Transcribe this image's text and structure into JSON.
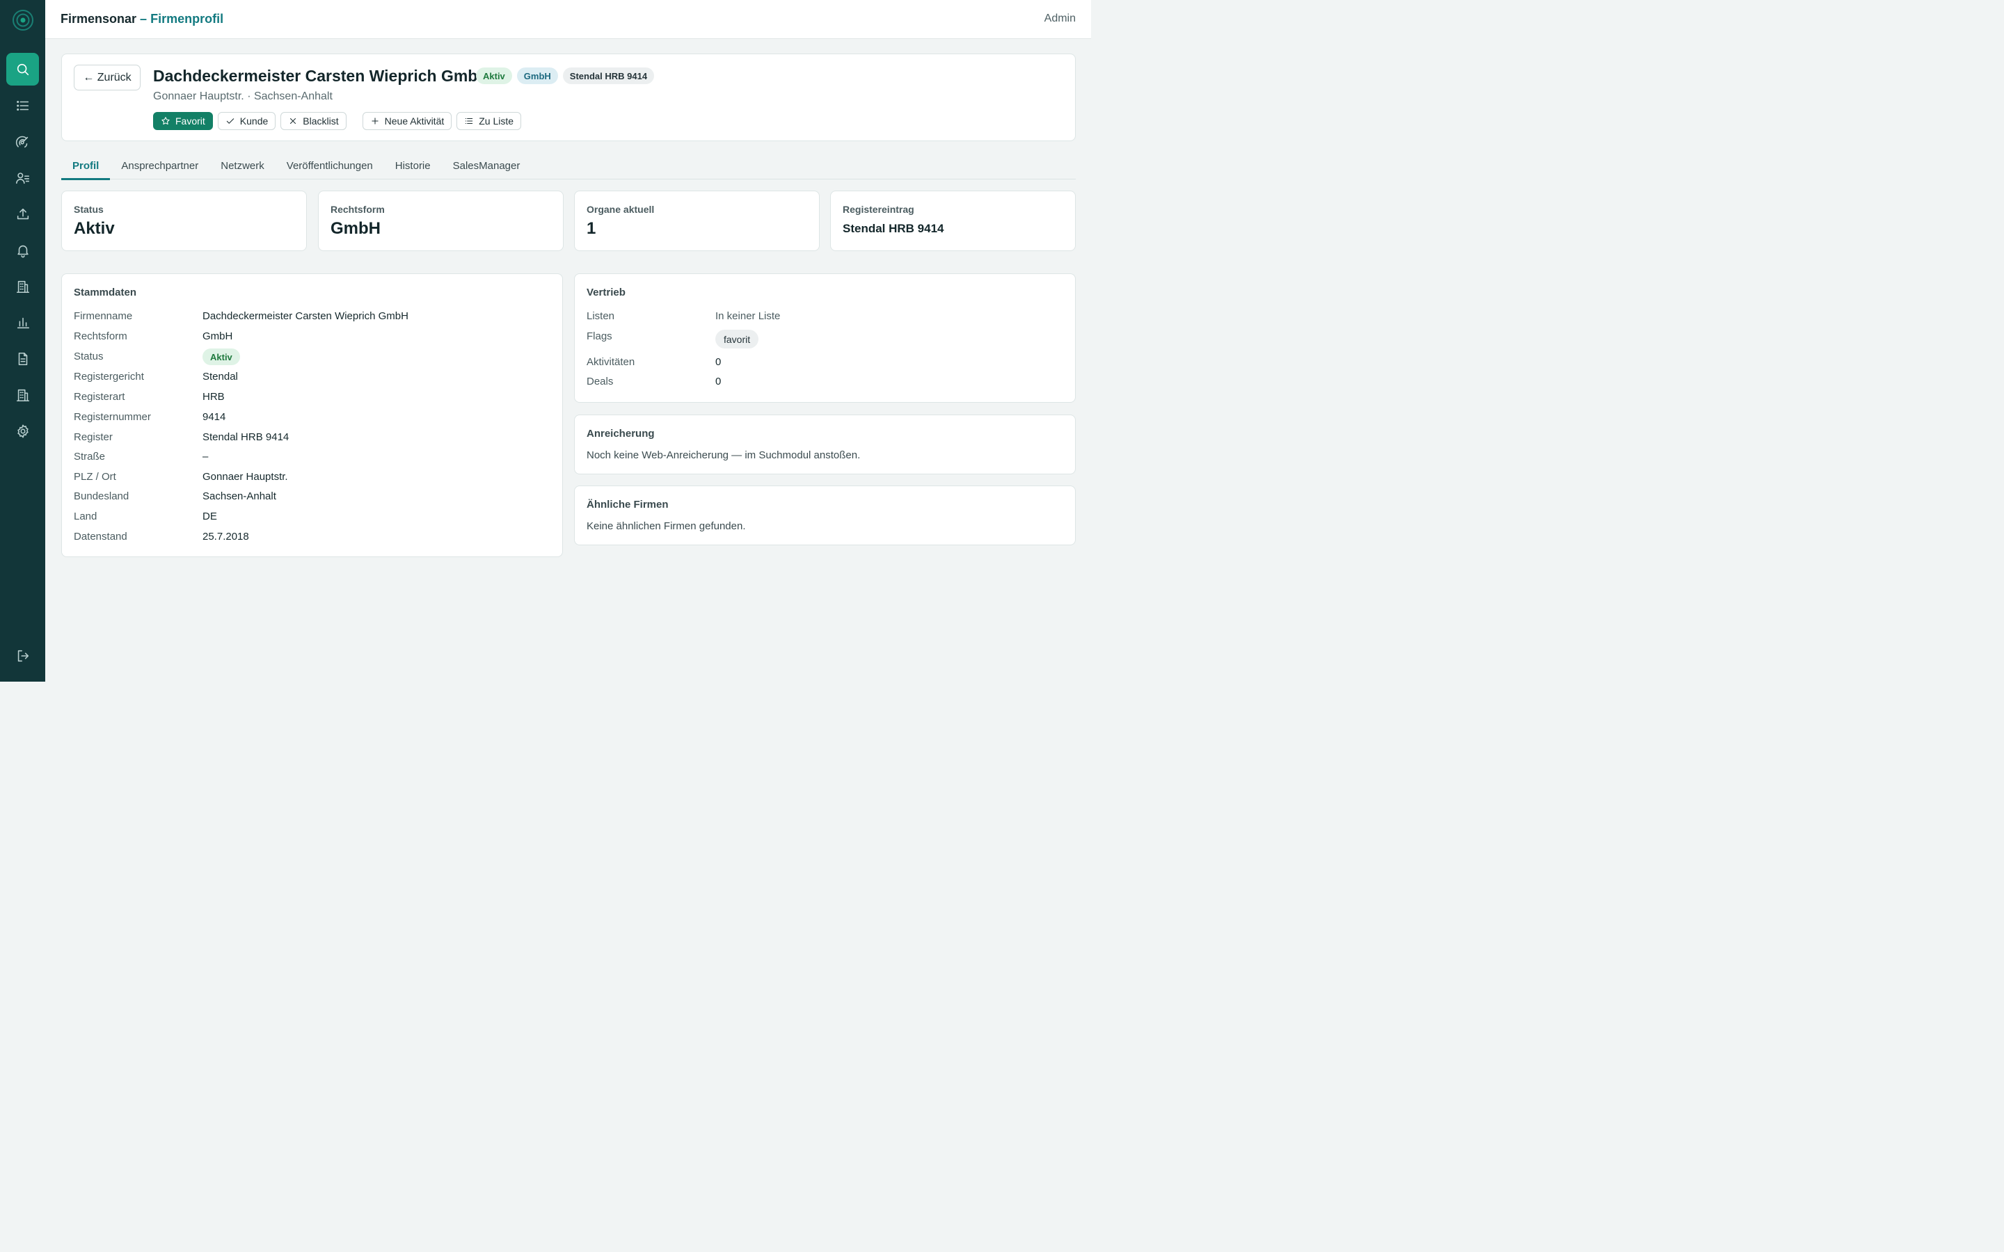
{
  "app": {
    "name": "Firmensonar",
    "separator": "–",
    "page": "Firmenprofil",
    "user": "Admin"
  },
  "header": {
    "back_label": "← Zurück",
    "company_name": "Dachdeckermeister Carsten Wieprich GmbH",
    "badges": [
      "Aktiv",
      "GmbH",
      "Stendal HRB 9414"
    ],
    "address": "Gonnaer Hauptstr. · Sachsen-Anhalt",
    "actions": {
      "favorite": "Favorit",
      "customer": "Kunde",
      "blacklist": "Blacklist",
      "new_activity": "Neue Aktivität",
      "to_list": "Zu Liste"
    }
  },
  "tabs": [
    "Profil",
    "Ansprechpartner",
    "Netzwerk",
    "Veröffentlichungen",
    "Historie",
    "SalesManager"
  ],
  "stats": [
    {
      "label": "Status",
      "value": "Aktiv"
    },
    {
      "label": "Rechtsform",
      "value": "GmbH"
    },
    {
      "label": "Organe aktuell",
      "value": "1"
    },
    {
      "label": "Registereintrag",
      "value": "Stendal HRB 9414"
    }
  ],
  "stammdaten": {
    "title": "Stammdaten",
    "rows": [
      {
        "key": "Firmenname",
        "value": "Dachdeckermeister Carsten Wieprich GmbH"
      },
      {
        "key": "Rechtsform",
        "value": "GmbH"
      },
      {
        "key": "Status",
        "value": "Aktiv"
      },
      {
        "key": "Registergericht",
        "value": "Stendal"
      },
      {
        "key": "Registerart",
        "value": "HRB"
      },
      {
        "key": "Registernummer",
        "value": "9414"
      },
      {
        "key": "Register",
        "value": "Stendal HRB 9414"
      },
      {
        "key": "Straße",
        "value": "–"
      },
      {
        "key": "PLZ / Ort",
        "value": "Gonnaer Hauptstr."
      },
      {
        "key": "Bundesland",
        "value": "Sachsen-Anhalt"
      },
      {
        "key": "Land",
        "value": "DE"
      },
      {
        "key": "Datenstand",
        "value": "25.7.2018"
      }
    ]
  },
  "vertrieb": {
    "title": "Vertrieb",
    "rows": [
      {
        "key": "Listen",
        "value": "In keiner Liste"
      },
      {
        "key": "Flags",
        "value": "favorit"
      },
      {
        "key": "Aktivitäten",
        "value": "0"
      },
      {
        "key": "Deals",
        "value": "0"
      }
    ]
  },
  "anreicherung": {
    "title": "Anreicherung",
    "text": "Noch keine Web-Anreicherung — im Suchmodul anstoßen."
  },
  "aehnliche": {
    "title": "Ähnliche Firmen",
    "text": "Keine ähnlichen Firmen gefunden."
  },
  "colors": {
    "sidebar": "#123639",
    "accent": "#137a80",
    "primary_button": "#138066",
    "active_nav": "#1aa384"
  }
}
